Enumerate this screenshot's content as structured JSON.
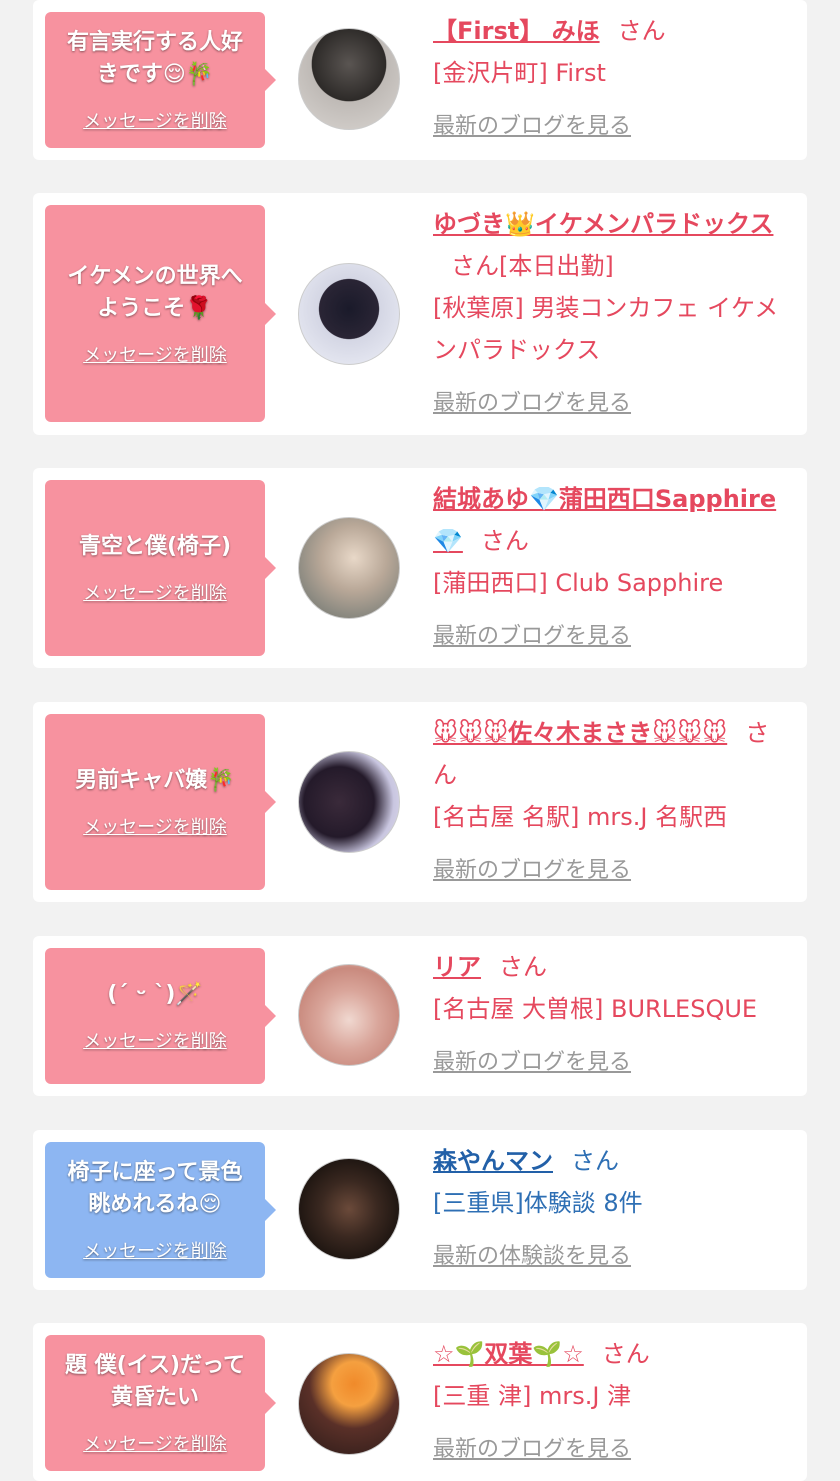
{
  "colors": {
    "pink_bubble": "#f7929f",
    "blue_bubble": "#8db6f2",
    "accent_pink": "#e5485e",
    "accent_blue": "#2260a8",
    "link_gray": "#999999"
  },
  "entries": [
    {
      "message": "有言実行する人好きです😌🎋",
      "delete_label": "メッセージを削除",
      "name": "【First】 みほ",
      "suffix": "さん",
      "shop": "[金沢片町] First",
      "link": "最新のブログを見る"
    },
    {
      "message": "イケメンの世界へようこそ🌹",
      "delete_label": "メッセージを削除",
      "name": "ゆづき👑イケメンパラドックス",
      "suffix": "さん[本日出勤]",
      "shop": "[秋葉原] 男装コンカフェ イケメンパラドックス",
      "link": "最新のブログを見る"
    },
    {
      "message": "青空と僕(椅子)",
      "delete_label": "メッセージを削除",
      "name": "結城あゆ💎蒲田西口Sapphire💎",
      "suffix": "さん",
      "shop": "[蒲田西口] Club Sapphire",
      "link": "最新のブログを見る"
    },
    {
      "message": "男前キャバ嬢🎋",
      "delete_label": "メッセージを削除",
      "name": "🐭🐭🐭佐々木まさき🐭🐭🐭",
      "suffix": "さん",
      "shop": "[名古屋 名駅] mrs.J 名駅西",
      "link": "最新のブログを見る"
    },
    {
      "message": "(ˊ ᵕ ˋ)🪄",
      "delete_label": "メッセージを削除",
      "name": "リア",
      "suffix": "さん",
      "shop": "[名古屋 大曽根] BURLESQUE",
      "link": "最新のブログを見る"
    },
    {
      "message": "椅子に座って景色眺めれるね😌",
      "delete_label": "メッセージを削除",
      "name": "森やんマン",
      "suffix": "さん",
      "shop": "[三重県]体験談 8件",
      "link": "最新の体験談を見る"
    },
    {
      "message": "題 僕(イス)だって黄昏たい",
      "delete_label": "メッセージを削除",
      "name": "☆🌱双葉🌱☆",
      "suffix": "さん",
      "shop": "[三重 津] mrs.J 津",
      "link": "最新のブログを見る"
    }
  ]
}
